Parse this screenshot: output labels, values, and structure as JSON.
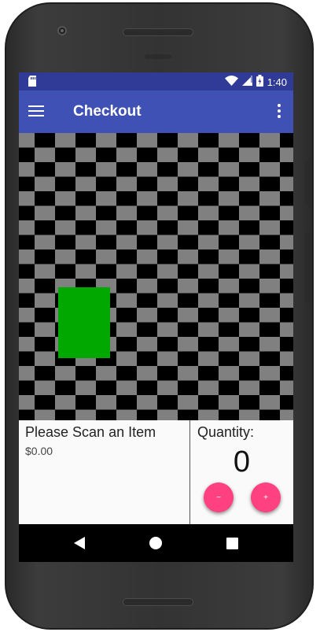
{
  "status_bar": {
    "time": "1:40",
    "icons": [
      "sd-card-icon",
      "wifi-icon",
      "cell-signal-icon",
      "battery-icon"
    ]
  },
  "app_bar": {
    "title": "Checkout",
    "nav_icon": "menu-icon",
    "overflow_icon": "more-vert-icon"
  },
  "camera": {
    "fab_icon": "camera-icon"
  },
  "item": {
    "name": "Please Scan an Item",
    "price": "$0.00"
  },
  "quantity": {
    "label": "Quantity:",
    "value": "0",
    "decrement_label": "−",
    "increment_label": "+"
  },
  "nav_bar": {
    "icons": [
      "back-icon",
      "home-icon",
      "recents-icon"
    ]
  },
  "colors": {
    "primary": "#3f51b5",
    "primary_dark": "#2f3b96",
    "accent": "#ff4081",
    "detected_object": "#00a800"
  }
}
